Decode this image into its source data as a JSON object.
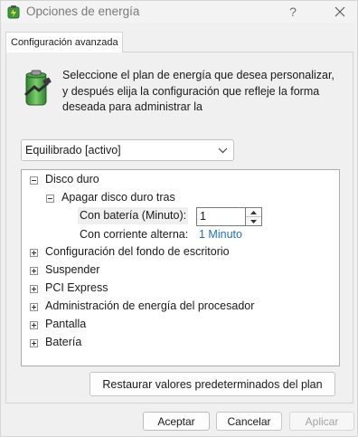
{
  "window": {
    "title": "Opciones de energía",
    "help_glyph": "?",
    "icon": "power-options-icon"
  },
  "tabs": [
    {
      "label": "Configuración avanzada",
      "selected": true
    }
  ],
  "description": "Seleccione el plan de energía que desea personalizar, y después elija la configuración que refleje la forma deseada para administrar la",
  "plan_select": {
    "value": "Equilibrado [activo]"
  },
  "tree": {
    "disco_duro": {
      "label": "Disco duro",
      "expanded": true
    },
    "apagar": {
      "label": "Apagar disco duro tras",
      "expanded": true
    },
    "battery_setting": {
      "label": "Con batería (Minuto):",
      "value": "1"
    },
    "ac_setting": {
      "label": "Con corriente alterna:",
      "value": "1 Minuto"
    },
    "collapsed_items": [
      {
        "label": "Configuración del fondo de escritorio"
      },
      {
        "label": "Suspender"
      },
      {
        "label": "PCI Express"
      },
      {
        "label": "Administración de energía del procesador"
      },
      {
        "label": "Pantalla"
      },
      {
        "label": "Batería"
      }
    ]
  },
  "buttons": {
    "restore": "Restaurar valores predeterminados del plan",
    "ok": "Aceptar",
    "cancel": "Cancelar",
    "apply": "Aplicar",
    "apply_enabled": false
  },
  "colors": {
    "link": "#1f6fbf",
    "disabled_text": "#a3a3a3"
  }
}
